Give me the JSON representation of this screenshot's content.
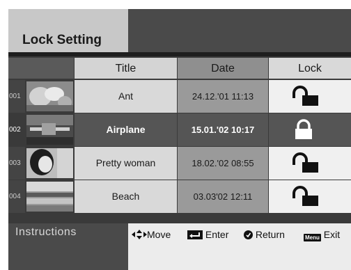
{
  "header": {
    "title": "Lock Setting"
  },
  "table": {
    "columns": {
      "title": "Title",
      "date": "Date",
      "lock": "Lock"
    },
    "rows": [
      {
        "num": "001",
        "title": "Ant",
        "date": "24.12.'01 11:13",
        "lock": "unlocked",
        "selected": false
      },
      {
        "num": "002",
        "title": "Airplane",
        "date": "15.01.'02 10:17",
        "lock": "locked",
        "selected": true
      },
      {
        "num": "003",
        "title": "Pretty woman",
        "date": "18.02.'02 08:55",
        "lock": "unlocked",
        "selected": false
      },
      {
        "num": "004",
        "title": "Beach",
        "date": "03.03'02 12:11",
        "lock": "unlocked",
        "selected": false
      }
    ]
  },
  "instructions": {
    "label": "Instructions",
    "move": "Move",
    "enter": "Enter",
    "return": "Return",
    "menu_key": "Menu",
    "exit": "Exit"
  },
  "icons": [
    "updown-leftright-arrows-icon",
    "enter-key-icon",
    "return-key-icon",
    "menu-key-icon",
    "padlock-open-icon",
    "padlock-closed-icon"
  ],
  "colors": {
    "background": "#3a3a3a",
    "header_tab": "#c8c8c8",
    "selected_row": "#555555",
    "cell_light": "#d9d9d9",
    "date_cell": "#9a9a9a"
  }
}
